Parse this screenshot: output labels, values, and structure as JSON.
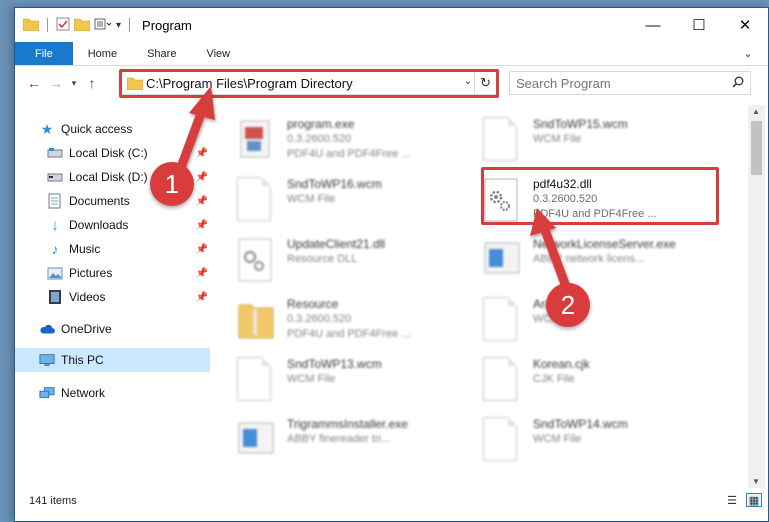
{
  "window": {
    "title": "Program",
    "controls": {
      "minimize": "—",
      "maximize": "☐",
      "close": "✕"
    }
  },
  "ribbon": {
    "tabs": [
      "File",
      "Home",
      "Share",
      "View"
    ],
    "expand_icon": "⌄"
  },
  "address_bar": {
    "path": "C:\\Program Files\\Program Directory",
    "search_placeholder": "Search Program"
  },
  "nav_pane": {
    "items": [
      {
        "label": "Quick access",
        "icon": "star-icon"
      },
      {
        "label": "Local Disk (C:)",
        "icon": "drive-icon",
        "pinned": true
      },
      {
        "label": "Local Disk (D:)",
        "icon": "drive-icon",
        "pinned": true
      },
      {
        "label": "Documents",
        "icon": "documents-icon",
        "pinned": true
      },
      {
        "label": "Downloads",
        "icon": "downloads-icon",
        "pinned": true
      },
      {
        "label": "Music",
        "icon": "music-icon",
        "pinned": true
      },
      {
        "label": "Pictures",
        "icon": "pictures-icon",
        "pinned": true
      },
      {
        "label": "Videos",
        "icon": "videos-icon",
        "pinned": true
      },
      {
        "label": "OneDrive",
        "icon": "cloud-icon"
      },
      {
        "label": "This PC",
        "icon": "computer-icon",
        "selected": true
      },
      {
        "label": "Network",
        "icon": "network-icon"
      }
    ]
  },
  "files": [
    {
      "name": "program.exe",
      "line2": "0.3.2600.520",
      "line3": "PDF4U and PDF4Free ...",
      "icon": "exe-icon"
    },
    {
      "name": "SndToWP15.wcm",
      "line2": "WCM File",
      "line3": "",
      "icon": "blank-file-icon"
    },
    {
      "name": "SndToWP16.wcm",
      "line2": "WCM File",
      "line3": "",
      "icon": "blank-file-icon"
    },
    {
      "name": "pdf4u32.dll",
      "line2": "0.3.2600.520",
      "line3": "PDF4U and PDF4Free ...",
      "icon": "dll-gear-icon"
    },
    {
      "name": "UpdateClient21.dll",
      "line2": "Resource DLL",
      "line3": "",
      "icon": "dll-gear-icon"
    },
    {
      "name": "NetworkLicenseServer.exe",
      "line2": "ABBY network licens...",
      "line3": "",
      "icon": "app-window-icon"
    },
    {
      "name": "Resource",
      "line2": "0.3.2600.520",
      "line3": "PDF4U and PDF4Free ...",
      "icon": "zip-folder-icon"
    },
    {
      "name": "Arabic.dd",
      "line2": "WCM File",
      "line3": "",
      "icon": "blank-file-icon"
    },
    {
      "name": "SndToWP13.wcm",
      "line2": "WCM File",
      "line3": "",
      "icon": "blank-file-icon"
    },
    {
      "name": "Korean.cjk",
      "line2": "CJK File",
      "line3": "",
      "icon": "blank-file-icon"
    },
    {
      "name": "TrigrammsInstaller.exe",
      "line2": "ABBY finereader tri...",
      "line3": "",
      "icon": "app-window-icon"
    },
    {
      "name": "SndToWP14.wcm",
      "line2": "WCM File",
      "line3": "",
      "icon": "blank-file-icon"
    }
  ],
  "status": {
    "item_count": "141 items"
  },
  "callouts": {
    "step1": "1",
    "step2": "2"
  },
  "colors": {
    "accent": "#1979ca",
    "highlight_red": "#d83c3c",
    "selected_bg": "#cce8ff"
  }
}
